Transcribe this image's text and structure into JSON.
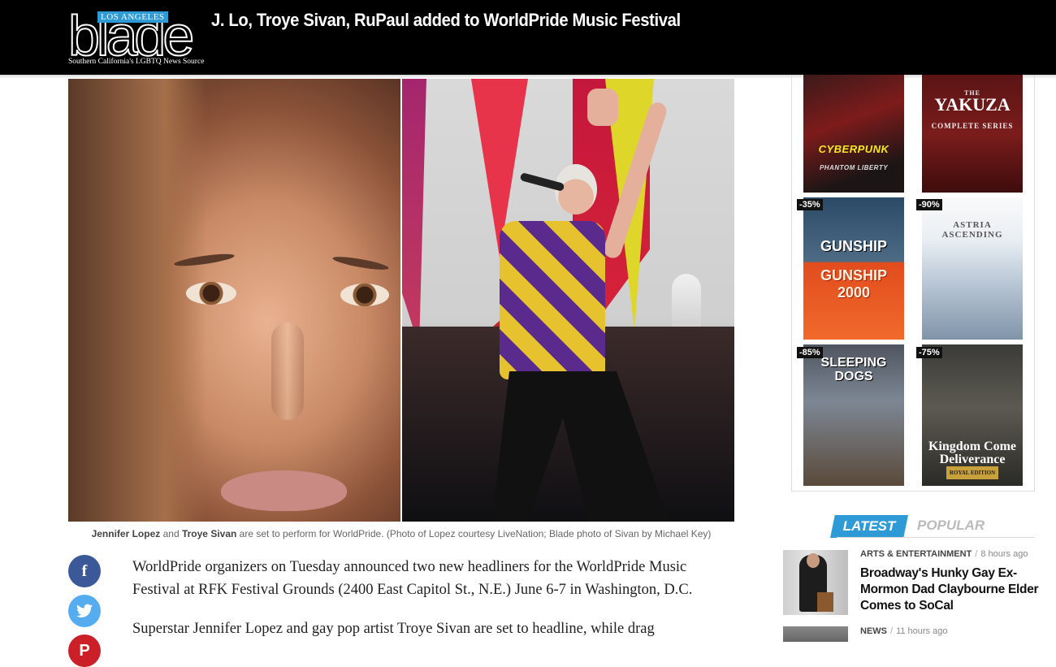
{
  "header": {
    "logo_tag": "LOS ANGELES",
    "logo_word": "blade",
    "logo_tagline": "Southern California's LGBTQ News Source",
    "headline": "J. Lo, Troye Sivan, RuPaul added to WorldPride Music Festival"
  },
  "caption": {
    "name1": "Jennifer Lopez",
    "and": " and ",
    "name2": "Troye Sivan",
    "rest": " are set to perform for WorldPride. (Photo of Lopez courtesy LiveNation; Blade photo of Sivan by Michael Key)"
  },
  "social": {
    "facebook": "f",
    "twitter": "🐦",
    "pinterest": "P"
  },
  "article": {
    "p1": "WorldPride organizers on Tuesday announced two new headliners for the WorldPride Music Festival at RFK Festival Grounds (2400 East Capitol St., N.E.) June 6-7 in Washington, D.C.",
    "p2": "Superstar Jennifer Lopez and gay pop artist Troye Sivan are set to headline, while drag"
  },
  "ads": {
    "game1": {
      "title": "CYBERPUNK",
      "subtitle": "PHANTOM LIBERTY"
    },
    "game2": {
      "title": "YAKUZA",
      "subtitle": "COMPLETE SERIES",
      "small": "THE"
    },
    "game3": {
      "title": "GUNSHIP",
      "subtitle": "GUNSHIP 2000",
      "discount": "-35%"
    },
    "game4": {
      "title": "ASTRIA ASCENDING",
      "discount": "-90%"
    },
    "game5": {
      "title": "SLEEPING DOGS",
      "discount": "-85%"
    },
    "game6": {
      "title": "Kingdom Come Deliverance",
      "subtitle": "ROYAL EDITION",
      "discount": "-75%"
    }
  },
  "tabs": {
    "latest": "LATEST",
    "popular": "POPULAR"
  },
  "news": [
    {
      "category": "ARTS & ENTERTAINMENT",
      "sep": "/",
      "time": "8 hours ago",
      "title": "Broadway's Hunky Gay Ex-Mormon Dad Claybourne Elder Comes to SoCal"
    },
    {
      "category": "NEWS",
      "sep": "/",
      "time": "11 hours ago"
    }
  ],
  "colors": {
    "accent": "#2e9bd6",
    "header_bg": "#000000",
    "facebook": "#3b5998",
    "twitter": "#55acee",
    "pinterest": "#cb2027"
  }
}
